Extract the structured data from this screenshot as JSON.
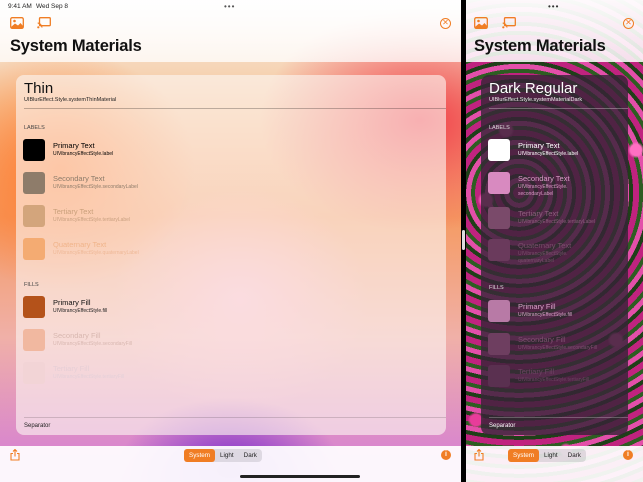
{
  "left": {
    "status_time": "9:41 AM",
    "status_date": "Wed Sep 8",
    "dots": "•••",
    "page_title": "System Materials",
    "material_title": "Thin",
    "material_subtitle": "UIBlurEffect.Style.systemThinMaterial",
    "labels_header": "LABELS",
    "labels": [
      {
        "title": "Primary Text",
        "sub": "UIVibrancyEffectStyle.label"
      },
      {
        "title": "Secondary Text",
        "sub": "UIVibrancyEffectStyle.secondaryLabel"
      },
      {
        "title": "Tertiary Text",
        "sub": "UIVibrancyEffectStyle.tertiaryLabel"
      },
      {
        "title": "Quaternary Text",
        "sub": "UIVibrancyEffectStyle.quaternaryLabel"
      }
    ],
    "fills_header": "FILLS",
    "fills": [
      {
        "title": "Primary Fill",
        "sub": "UIVibrancyEffectStyle.fill"
      },
      {
        "title": "Secondary Fill",
        "sub": "UIVibrancyEffectStyle.secondaryFill"
      },
      {
        "title": "Tertiary Fill",
        "sub": "UIVibrancyEffectStyle.tertiaryFill"
      }
    ],
    "separator_label": "Separator",
    "segments": [
      "System",
      "Light",
      "Dark"
    ],
    "info_label": "i"
  },
  "right": {
    "dots": "•••",
    "page_title": "System Materials",
    "material_title": "Dark Regular",
    "material_subtitle": "UIBlurEffect.Style.systemMaterialDark",
    "labels_header": "LABELS",
    "labels": [
      {
        "title": "Primary Text",
        "sub": "UIVibrancyEffectStyle.label"
      },
      {
        "title": "Secondary Text",
        "sub": "UIVibrancyEffectStyle.\nsecondaryLabel"
      },
      {
        "title": "Tertiary Text",
        "sub": "UIVibrancyEffectStyle.tertiaryLabel"
      },
      {
        "title": "Quaternary Text",
        "sub": "UIVibrancyEffectStyle.\nquaternaryLabel"
      }
    ],
    "fills_header": "FILLS",
    "fills": [
      {
        "title": "Primary Fill",
        "sub": "UIVibrancyEffectStyle.fill"
      },
      {
        "title": "Secondary Fill",
        "sub": "UIVibrancyEffectStyle.secondaryFill"
      },
      {
        "title": "Tertiary Fill",
        "sub": "UIVibrancyEffectStyle.tertiaryFill"
      }
    ],
    "separator_label": "Separator",
    "segments": [
      "System",
      "Light",
      "Dark"
    ],
    "info_label": "i"
  },
  "colors": {
    "accent": "#f07d24"
  },
  "selected_segment": "System"
}
